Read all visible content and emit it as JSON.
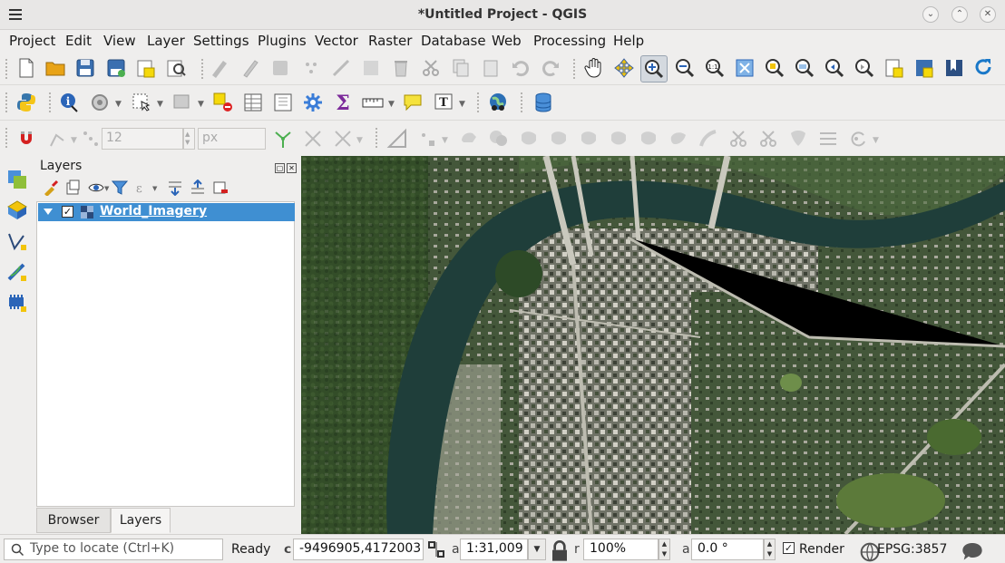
{
  "window": {
    "title": "*Untitled Project - QGIS"
  },
  "menubar": [
    "Project",
    "Edit",
    "View",
    "Layer",
    "Settings",
    "Plugins",
    "Vector",
    "Raster",
    "Database",
    "Web",
    "Processing",
    "Help"
  ],
  "snapping": {
    "tolerance_value": "12",
    "unit": "px"
  },
  "layers_panel": {
    "title": "Layers",
    "layers": [
      {
        "name": "World_Imagery",
        "visible": true,
        "selected": true
      }
    ],
    "tabs": [
      "Browser",
      "Layers"
    ],
    "active_tab": "Layers"
  },
  "statusbar": {
    "locate_placeholder": "Type to locate (Ctrl+K)",
    "status": "Ready",
    "coordinate": "-9496905,4172003",
    "scale": "1:31,009",
    "magnifier": "100%",
    "rotation": "0.0 °",
    "render_label": "Render",
    "render_checked": true,
    "crs": "EPSG:3857"
  },
  "colors": {
    "selection": "#3f8fd2",
    "river": "#1f3e3a"
  }
}
